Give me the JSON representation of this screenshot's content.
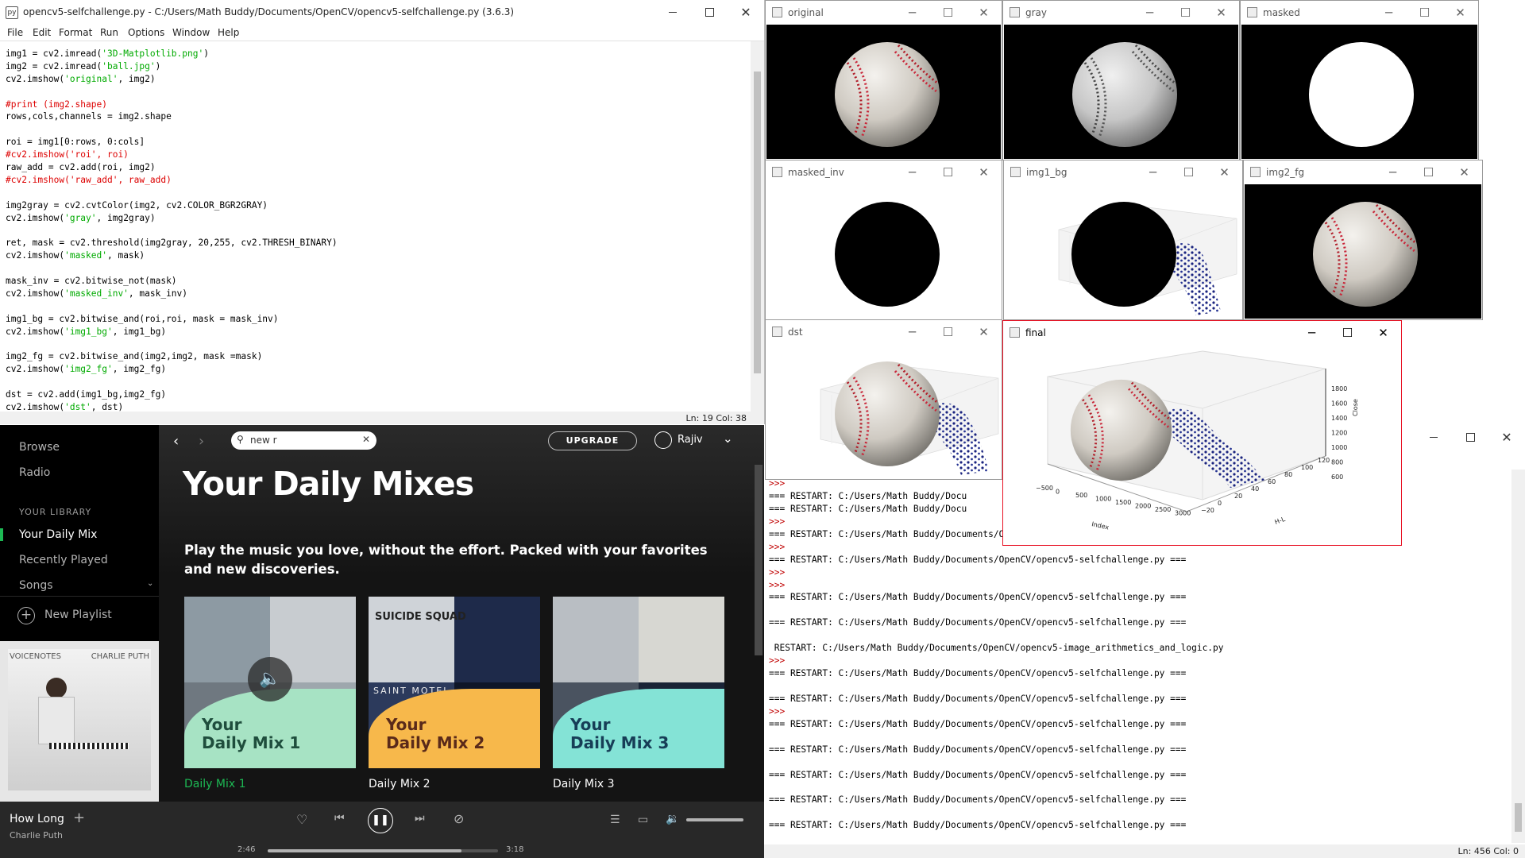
{
  "editor": {
    "title": "opencv5-selfchallenge.py - C:/Users/Math Buddy/Documents/OpenCV/opencv5-selfchallenge.py (3.6.3)",
    "menu": [
      "File",
      "Edit",
      "Format",
      "Run",
      "Options",
      "Window",
      "Help"
    ],
    "status": "Ln: 19   Col: 38",
    "code_lines": [
      [
        [
          "",
          "img1 = cv2.imread("
        ],
        [
          "st",
          "'3D-Matplotlib.png'"
        ],
        [
          "",
          ")"
        ]
      ],
      [
        [
          "",
          "img2 = cv2.imread("
        ],
        [
          "st",
          "'ball.jpg'"
        ],
        [
          "",
          ")"
        ]
      ],
      [
        [
          "",
          "cv2.imshow("
        ],
        [
          "st",
          "'original'"
        ],
        [
          "",
          ", img2)"
        ]
      ],
      [],
      [
        [
          "cm",
          "#print (img2.shape)"
        ]
      ],
      [
        [
          "",
          "rows,cols,channels = img2.shape"
        ]
      ],
      [],
      [
        [
          "",
          "roi = img1[0:rows, 0:cols]"
        ]
      ],
      [
        [
          "cm",
          "#cv2.imshow('roi', roi)"
        ]
      ],
      [
        [
          "",
          "raw_add = cv2.add(roi, img2)"
        ]
      ],
      [
        [
          "cm",
          "#cv2.imshow('raw_add', raw_add)"
        ]
      ],
      [],
      [
        [
          "",
          "img2gray = cv2.cvtColor(img2, cv2.COLOR_BGR2GRAY)"
        ]
      ],
      [
        [
          "",
          "cv2.imshow("
        ],
        [
          "st",
          "'gray'"
        ],
        [
          "",
          ", img2gray)"
        ]
      ],
      [],
      [
        [
          "",
          "ret, mask = cv2.threshold(img2gray, 20,255, cv2.THRESH_BINARY)"
        ]
      ],
      [
        [
          "",
          "cv2.imshow("
        ],
        [
          "st",
          "'masked'"
        ],
        [
          "",
          ", mask)"
        ]
      ],
      [],
      [
        [
          "",
          "mask_inv = cv2.bitwise_not(mask)"
        ]
      ],
      [
        [
          "",
          "cv2.imshow("
        ],
        [
          "st",
          "'masked_inv'"
        ],
        [
          "",
          ", mask_inv)"
        ]
      ],
      [],
      [
        [
          "",
          "img1_bg = cv2.bitwise_and(roi,roi, mask = mask_inv)"
        ]
      ],
      [
        [
          "",
          "cv2.imshow("
        ],
        [
          "st",
          "'img1_bg'"
        ],
        [
          "",
          ", img1_bg)"
        ]
      ],
      [],
      [
        [
          "",
          "img2_fg = cv2.bitwise_and(img2,img2, mask =mask)"
        ]
      ],
      [
        [
          "",
          "cv2.imshow("
        ],
        [
          "st",
          "'img2_fg'"
        ],
        [
          "",
          ", img2_fg)"
        ]
      ],
      [],
      [
        [
          "",
          "dst = cv2.add(img1_bg,img2_fg)"
        ]
      ],
      [
        [
          "",
          "cv2.imshow("
        ],
        [
          "st",
          "'dst'"
        ],
        [
          "",
          ", dst)"
        ]
      ]
    ]
  },
  "cv_windows": {
    "original": "original",
    "gray": "gray",
    "masked": "masked",
    "masked_inv": "masked_inv",
    "img1_bg": "img1_bg",
    "img2_fg": "img2_fg",
    "dst": "dst",
    "final": "final"
  },
  "plot": {
    "z_ticks": [
      "1800",
      "1600",
      "1400",
      "1200",
      "1000",
      "800",
      "600"
    ],
    "z_label": "Close",
    "x_ticks": [
      "−500",
      "0",
      "500",
      "1000",
      "1500",
      "2000",
      "2500",
      "3000"
    ],
    "x_label": "Index",
    "y_ticks": [
      "−20",
      "0",
      "20",
      "40",
      "60",
      "80",
      "100",
      "120"
    ],
    "y_label": "H-L"
  },
  "spotify": {
    "nav": [
      "Browse",
      "Radio"
    ],
    "library_header": "YOUR LIBRARY",
    "library": [
      "Your Daily Mix",
      "Recently Played",
      "Songs"
    ],
    "new_playlist": "New Playlist",
    "search_value": "new r",
    "upgrade": "UPGRADE",
    "user": "Rajiv",
    "heading": "Your Daily Mixes",
    "subheading": "Play the music you love, without the effort. Packed with your favorites and new discoveries.",
    "album_art_left": "VOICENOTES",
    "album_art_right": "CHARLIE PUTH",
    "mixes": [
      {
        "label1": "Your",
        "label2": "Daily Mix 1",
        "name": "Daily Mix 1",
        "bg": "#a7e3c4",
        "text": "#1f4e3d"
      },
      {
        "label1": "Your",
        "label2": "Daily Mix 2",
        "name": "Daily Mix 2",
        "bg": "#f7b84b",
        "text": "#5a2a1a"
      },
      {
        "label1": "Your",
        "label2": "Daily Mix 3",
        "name": "Daily Mix 3",
        "bg": "#84e3d6",
        "text": "#173e57"
      }
    ],
    "mix2_art_top": "SUICIDE SQUAD",
    "mix2_art_band": "SAINT MOTEL",
    "track_title": "How Long",
    "track_artist": "Charlie Puth",
    "elapsed": "2:46",
    "duration": "3:18",
    "progress": 0.84,
    "volume": 1.0,
    "accent": "#1db954"
  },
  "shell": {
    "status": "Ln: 456   Col: 0",
    "lines": [
      [
        "prompt",
        ">>>"
      ],
      [
        "text",
        "=== RESTART: C:/Users/Math Buddy/Docu"
      ],
      [
        "text",
        "=== RESTART: C:/Users/Math Buddy/Docu"
      ],
      [
        "prompt",
        ">>>"
      ],
      [
        "text",
        "=== RESTART: C:/Users/Math Buddy/Documents/OpenCV/opencv5-selfchallenge.py ==="
      ],
      [
        "prompt",
        ">>>"
      ],
      [
        "text",
        "=== RESTART: C:/Users/Math Buddy/Documents/OpenCV/opencv5-selfchallenge.py ==="
      ],
      [
        "prompt",
        ">>>"
      ],
      [
        "prompt",
        ">>>"
      ],
      [
        "text",
        "=== RESTART: C:/Users/Math Buddy/Documents/OpenCV/opencv5-selfchallenge.py ==="
      ],
      [
        "blank",
        ""
      ],
      [
        "text",
        "=== RESTART: C:/Users/Math Buddy/Documents/OpenCV/opencv5-selfchallenge.py ==="
      ],
      [
        "blank",
        ""
      ],
      [
        "text",
        " RESTART: C:/Users/Math Buddy/Documents/OpenCV/opencv5-image_arithmetics_and_logic.py"
      ],
      [
        "prompt",
        ">>>"
      ],
      [
        "text",
        "=== RESTART: C:/Users/Math Buddy/Documents/OpenCV/opencv5-selfchallenge.py ==="
      ],
      [
        "blank",
        ""
      ],
      [
        "text",
        "=== RESTART: C:/Users/Math Buddy/Documents/OpenCV/opencv5-selfchallenge.py ==="
      ],
      [
        "prompt",
        ">>>"
      ],
      [
        "text",
        "=== RESTART: C:/Users/Math Buddy/Documents/OpenCV/opencv5-selfchallenge.py ==="
      ],
      [
        "blank",
        ""
      ],
      [
        "text",
        "=== RESTART: C:/Users/Math Buddy/Documents/OpenCV/opencv5-selfchallenge.py ==="
      ],
      [
        "blank",
        ""
      ],
      [
        "text",
        "=== RESTART: C:/Users/Math Buddy/Documents/OpenCV/opencv5-selfchallenge.py ==="
      ],
      [
        "blank",
        ""
      ],
      [
        "text",
        "=== RESTART: C:/Users/Math Buddy/Documents/OpenCV/opencv5-selfchallenge.py ==="
      ],
      [
        "blank",
        ""
      ],
      [
        "text",
        "=== RESTART: C:/Users/Math Buddy/Documents/OpenCV/opencv5-selfchallenge.py ==="
      ]
    ]
  }
}
